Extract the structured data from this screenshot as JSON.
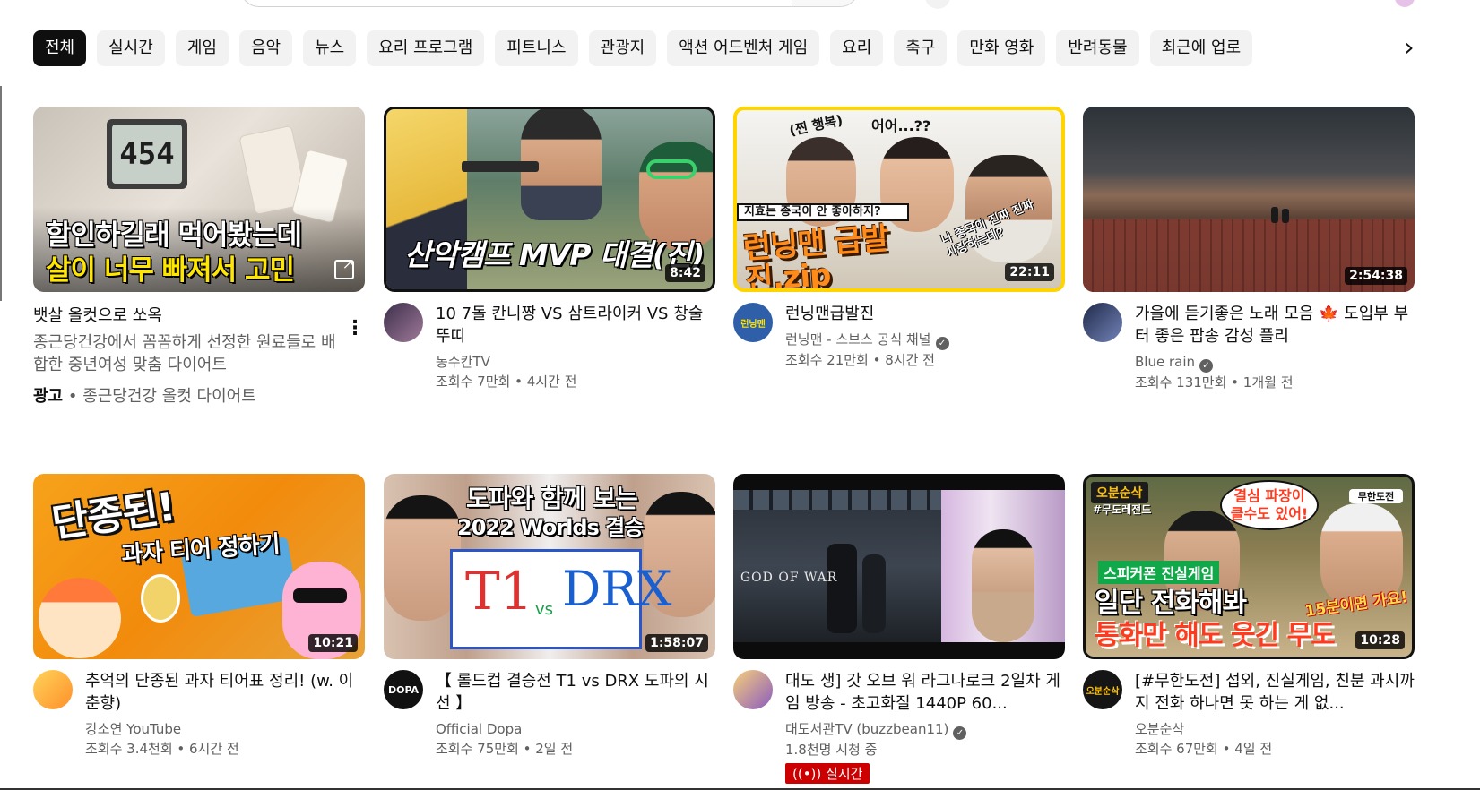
{
  "chips": [
    "전체",
    "실시간",
    "게임",
    "음악",
    "뉴스",
    "요리 프로그램",
    "피트니스",
    "관광지",
    "액션 어드벤처 게임",
    "요리",
    "축구",
    "만화 영화",
    "반려동물",
    "최근에 업로"
  ],
  "ad": {
    "title": "뱃살 올컷으로 쏘옥",
    "desc": "종근당건강에서 꼼꼼하게 선정한 원료들로 배합한 중년여성 맞춤 다이어트",
    "label": "광고",
    "sponsor": "종근당건강 올컷 다이어트",
    "thumb_line1": "할인하길래 먹어봤는데",
    "thumb_line2": "살이 너무 빠져서 고민",
    "scale_value": "454"
  },
  "videos": [
    {
      "title": "10 7돌 칸니짱 VS 삼트라이커 VS 창술 뚜띠",
      "channel": "동수칸TV",
      "stats": "조회수 7만회 • 4시간 전",
      "duration": "8:42",
      "thumb_text": "산악캠프 MVP 대결(진)"
    },
    {
      "title": "런닝맨급발진",
      "channel": "런닝맨 - 스브스 공식 채널",
      "stats": "조회수 21만회 • 8시간 전",
      "duration": "22:11",
      "thumb_text": "런닝맨 급발진.zip",
      "thumb_caption": "지효는 종국이 안 좋아하지?",
      "thumb_bubble1": "(찐 행복)",
      "thumb_bubble2": "어어...??",
      "thumb_bubble3": "나 종국이 진짜 진짜 사랑하는데?",
      "avatar_text": "런닝맨"
    },
    {
      "title": "가을에 듣기좋은 노래 모음 🍁 도입부 부터 좋은 팝송 감성 플리",
      "channel": "Blue rain",
      "stats": "조회수 131만회 • 1개월 전",
      "duration": "2:54:38"
    },
    {
      "title": "추억의 단종된 과자 티어표 정리! (w. 이춘향)",
      "channel": "강소연 YouTube",
      "stats": "조회수 3.4천회 • 6시간 전",
      "duration": "10:21",
      "thumb_text1": "단종된!",
      "thumb_text2": "과자 티어 정하기"
    },
    {
      "title": "【 롤드컵 결승전 T1 vs DRX 도파의 시선 】",
      "channel": "Official Dopa",
      "stats": "조회수 75만회 • 2일 전",
      "duration": "1:58:07",
      "thumb_text1": "도파와 함께 보는",
      "thumb_text2": "2022 Worlds 결승",
      "board_left": "T1",
      "board_mid": "vs",
      "board_right": "DRX",
      "avatar_text": "DOPA"
    },
    {
      "title": "대도 생] 갓 오브 워 라그나로크 2일차 게임 방송 - 초고화질 1440P 60...",
      "channel": "대도서관TV (buzzbean11)",
      "stats": "1.8천명 시청 중",
      "live": "실시간",
      "thumb_text": "GOD OF WAR"
    },
    {
      "title": "[#무한도전] 섭외, 진실게임, 친분 과시까지 전화 하나면 못 하는 게 없...",
      "channel": "오분순삭",
      "stats": "조회수 67만회 • 4일 전",
      "duration": "10:28",
      "thumb_text1": "일단 전화해봐",
      "thumb_text2": "통화만 해도 웃긴 무도",
      "thumb_badge": "오분순삭",
      "thumb_tag": "#무도레전드",
      "thumb_bubble": "결심 파장이 클수도 있어!",
      "thumb_sub": "스피커폰 진실게임",
      "thumb_logo": "무한도전",
      "thumb_time": "15분이면 가요!",
      "avatar_text": "오분순삭"
    }
  ],
  "colors": {
    "accent_red": "#cc0000",
    "chip_bg": "#f2f2f2",
    "active_chip": "#0f0f0f",
    "meta_gray": "#606060"
  }
}
